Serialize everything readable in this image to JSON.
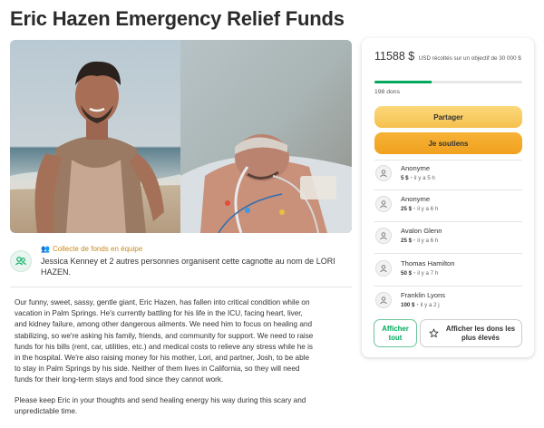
{
  "page": {
    "title": "Eric Hazen Emergency Relief Funds"
  },
  "hero": {
    "left_photo_icon": "man-on-beach-photo",
    "right_photo_icon": "hospital-icu-photo"
  },
  "organizer": {
    "tag_icon": "team-icon",
    "tag": "Collecte de fonds en équipe",
    "text": "Jessica Kenney et 2 autres personnes organisent cette cagnotte au nom de LORI HAZEN.",
    "icon": "team-avatar-icon"
  },
  "story": {
    "paragraphs": [
      "Our funny, sweet, sassy, gentle giant, Eric Hazen, has fallen into critical condition while on vacation in Palm Springs. He's currently battling for his life in the ICU, facing heart, liver, and kidney failure, among other dangerous ailments. We need him to focus on healing and stabilizing, so we're asking his family, friends, and community for support. We need to raise funds for his bills (rent, car, utilities, etc.) and medical costs to relieve any stress while he is in the hospital. We're also raising money for his mother, Lori, and partner, Josh, to be able to stay in Palm Springs by his side. Neither of them lives in California, so they will need funds for their long-term stays and food since they cannot work.",
      "Please keep Eric in your thoughts and send healing energy his way during this scary and unpredictable time."
    ]
  },
  "sidebar": {
    "amount": "11588 $",
    "amount_sub": "USD récoltés sur un objectif de 30 000 $",
    "progress_fraction": 0.386,
    "donations": "198 dons",
    "share_label": "Partager",
    "donate_label": "Je soutiens",
    "donors": [
      {
        "name": "Anonyme",
        "amount": "5 $",
        "time": "il y a 5 h"
      },
      {
        "name": "Anonyme",
        "amount": "25 $",
        "time": "il y a 6 h"
      },
      {
        "name": "Avalon Glenn",
        "amount": "25 $",
        "time": "il y a 6 h"
      },
      {
        "name": "Thomas Hamilton",
        "amount": "50 $",
        "time": "il y a 7 h"
      },
      {
        "name": "Franklin Lyons",
        "amount": "100 $",
        "time": "il y a 2 j"
      }
    ],
    "see_all_label": "Afficher tout",
    "top_label": "Afficher les dons les plus élevés",
    "top_icon": "star-icon"
  },
  "colors": {
    "brand_green": "#02a95c",
    "share_yellow": "#f5c14e",
    "donate_orange": "#f0a11f"
  }
}
